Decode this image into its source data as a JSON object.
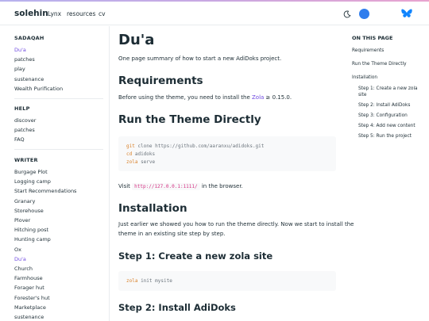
{
  "navbar": {
    "brand": "solehin",
    "links": [
      "Lynx",
      "resources",
      "cv"
    ]
  },
  "sidebar": {
    "sections": [
      {
        "title": "SADAQAH",
        "items": [
          "Du'a",
          "patches",
          "play",
          "sustenance",
          "Wealth Purification"
        ]
      },
      {
        "title": "HELP",
        "items": [
          "discover",
          "patches",
          "FAQ"
        ]
      },
      {
        "title": "WRITER",
        "items": [
          "Burgage Plot",
          "Logging camp",
          "Start Recommendations",
          "Granary",
          "Storehouse",
          "Plover",
          "Hitching post",
          "Hunting camp",
          "Ox",
          "Du'a",
          "Church",
          "Farmhouse",
          "Forager hut",
          "Forester's hut",
          "Marketplace",
          "sustenance"
        ]
      }
    ],
    "active_item": "Du'a"
  },
  "content": {
    "title": "Du'a",
    "summary": "One page summary of how to start a new AdiDoks project.",
    "requirements_heading": "Requirements",
    "requirements_text_pre": "Before using the theme, you need to install the ",
    "requirements_link": "Zola",
    "requirements_text_post": " ≥ 0.15.0.",
    "run_heading": "Run the Theme Directly",
    "run_code": [
      {
        "kw": "git",
        "rest": " clone https://github.com/aaranxu/adidoks.git"
      },
      {
        "kw": "cd",
        "rest": " adidoks"
      },
      {
        "kw": "zola",
        "rest": " serve"
      }
    ],
    "visit_pre": "Visit ",
    "visit_code": "http://127.0.0.1:1111/",
    "visit_post": " in the browser.",
    "install_heading": "Installation",
    "install_text_1": "Just earlier we showed you how to run the theme directly. Now we start to install the",
    "install_text_2": "theme in an existing site step by step.",
    "step1_heading": "Step 1: Create a new zola site",
    "step1_code": {
      "kw": "zola",
      "rest": " init mysite"
    },
    "step2_heading": "Step 2: Install AdiDoks"
  },
  "toc": {
    "title": "ON THIS PAGE",
    "items": [
      "Requirements",
      "Run the Theme Directly",
      "Installation"
    ],
    "sub_items": [
      "Step 1: Create a new zola",
      "site",
      "Step 2: Install AdiDoks",
      "Step 3: Configuration",
      "Step 4: Add new content",
      "Step 5: Run the project"
    ]
  },
  "colors": {
    "accent": "#6f4ae0",
    "avatar": "#2f7ded",
    "bluesky": "#1185fe",
    "code_keyword": "#d9822b"
  },
  "icons": {
    "theme_toggle": "moon-icon",
    "social": "bluesky-butterfly-icon"
  }
}
